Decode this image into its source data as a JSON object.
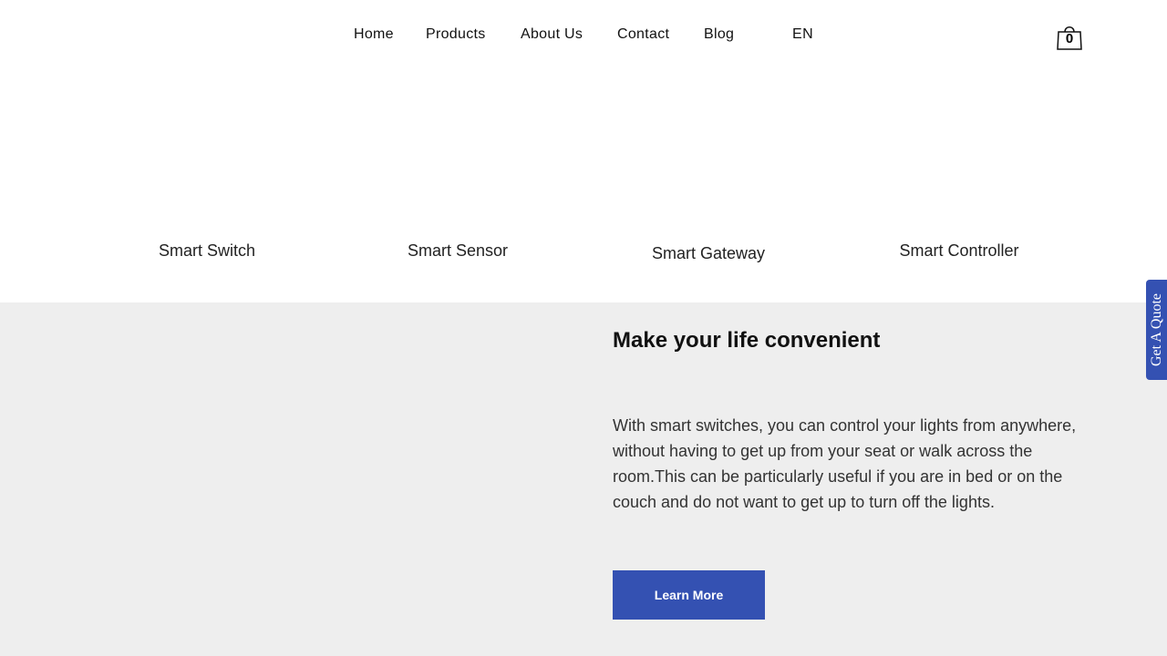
{
  "nav": {
    "items": [
      {
        "label": "Home"
      },
      {
        "label": "Products"
      },
      {
        "label": "About Us"
      },
      {
        "label": "Contact"
      },
      {
        "label": "Blog"
      }
    ],
    "language": "EN",
    "cart_count": "0",
    "cart_icon": "shopping-bag-icon"
  },
  "products": [
    {
      "label": "Smart Switch"
    },
    {
      "label": "Smart Sensor"
    },
    {
      "label": "Smart Gateway"
    },
    {
      "label": "Smart Controller"
    }
  ],
  "feature": {
    "title": "Make your life convenient",
    "body": "With smart switches, you can control your lights from anywhere, without having to get up from your seat or walk across the room.This can be particularly useful if you are in bed or on the couch and do not want to get up to turn off the lights.",
    "button_label": "Learn More"
  },
  "quote_tab": {
    "label": "Get A Quote"
  },
  "colors": {
    "accent": "#3451b2",
    "section_bg": "#eeeeee"
  }
}
